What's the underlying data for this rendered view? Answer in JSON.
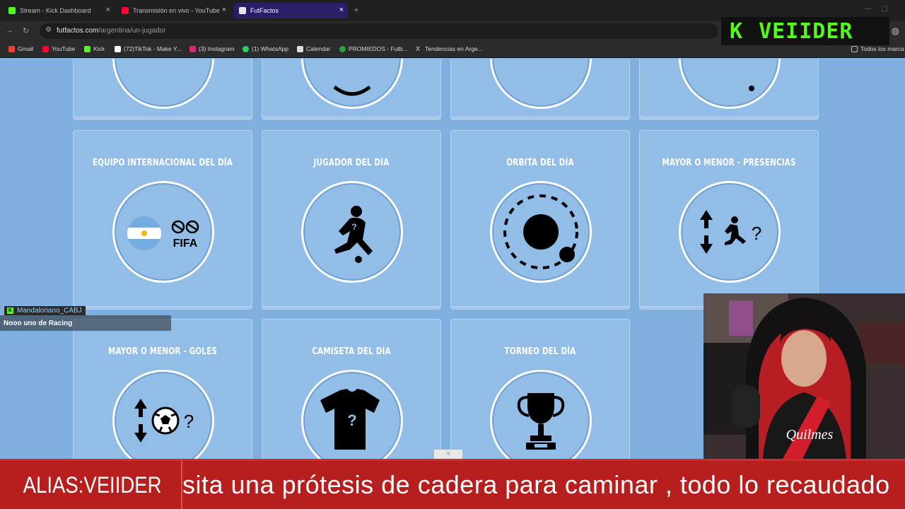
{
  "browser": {
    "tabs": [
      {
        "label": "Stream - Kick Dashboard",
        "fav_color": "#53fc18"
      },
      {
        "label": "Transmisión en vivo - YouTube",
        "fav_color": "#ff0033"
      },
      {
        "label": "FutFactos",
        "fav_color": "#e6e6e6"
      }
    ],
    "url_host": "futfactos.com",
    "url_path": "/argentina/un-jugador",
    "bookmarks": [
      {
        "label": "Gmail",
        "color": "#ea4335"
      },
      {
        "label": "YouTube",
        "color": "#ff0033"
      },
      {
        "label": "Kick",
        "color": "#53fc18"
      },
      {
        "label": "(72)TikTok - Make Y...",
        "color": "#ffffff"
      },
      {
        "label": "(3) Instagram",
        "color": "#d62976"
      },
      {
        "label": "(1) WhatsApp",
        "color": "#25d366"
      },
      {
        "label": "Calendar",
        "color": "#dddddd"
      },
      {
        "label": "PROMIEDOS - Futb...",
        "color": "#2e9e3e"
      },
      {
        "label": "Tendencias en Arge...",
        "color": "#dddddd"
      },
      {
        "label": "Todos los marca",
        "color": "#bbbbbb"
      }
    ]
  },
  "overlay": {
    "brand_k": "K",
    "brand_name": "VEIIDER",
    "chat_user": "Mandaloriano_CABJ",
    "chat_message": "Nooo uno de Racing",
    "ticker_alias": "ALIAS:VEIIDER",
    "ticker_text": "sita una prótesis de cadera para caminar , todo lo recaudado"
  },
  "games": [
    {
      "title": "",
      "icon": "partial-icon"
    },
    {
      "title": "",
      "icon": "partial-icon"
    },
    {
      "title": "",
      "icon": "partial-icon"
    },
    {
      "title": "",
      "icon": "partial-icon"
    },
    {
      "title": "EQUIPO INTERNACIONAL DEL DÍA",
      "icon": "argentina-fifa-icon"
    },
    {
      "title": "JUGADOR DEL DÍA",
      "icon": "mystery-player-icon"
    },
    {
      "title": "ÓRBITA DEL DÍA",
      "icon": "orbit-icon"
    },
    {
      "title": "MAYOR O MENOR - PRESENCIAS",
      "icon": "higher-lower-player-icon"
    },
    {
      "title": "MAYOR O MENOR - GOLES",
      "icon": "higher-lower-ball-icon"
    },
    {
      "title": "CAMISETA DEL DÍA",
      "icon": "mystery-shirt-icon"
    },
    {
      "title": "TORNEO DEL DÍA",
      "icon": "trophy-icon"
    }
  ],
  "icon_texts": {
    "fifa": "FIFA",
    "question": "?"
  }
}
